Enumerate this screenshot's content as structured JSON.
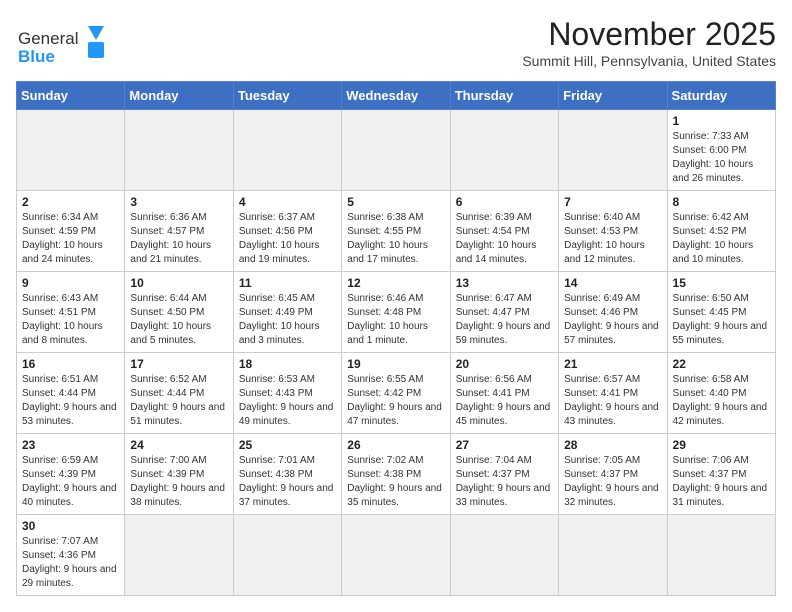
{
  "header": {
    "logo_general": "General",
    "logo_blue": "Blue",
    "title": "November 2025",
    "subtitle": "Summit Hill, Pennsylvania, United States"
  },
  "days_of_week": [
    "Sunday",
    "Monday",
    "Tuesday",
    "Wednesday",
    "Thursday",
    "Friday",
    "Saturday"
  ],
  "weeks": [
    [
      {
        "day": "",
        "empty": true
      },
      {
        "day": "",
        "empty": true
      },
      {
        "day": "",
        "empty": true
      },
      {
        "day": "",
        "empty": true
      },
      {
        "day": "",
        "empty": true
      },
      {
        "day": "",
        "empty": true
      },
      {
        "day": "1",
        "sunrise": "7:33 AM",
        "sunset": "6:00 PM",
        "daylight": "10 hours and 26 minutes."
      }
    ],
    [
      {
        "day": "2",
        "sunrise": "6:34 AM",
        "sunset": "4:59 PM",
        "daylight": "10 hours and 24 minutes."
      },
      {
        "day": "3",
        "sunrise": "6:36 AM",
        "sunset": "4:57 PM",
        "daylight": "10 hours and 21 minutes."
      },
      {
        "day": "4",
        "sunrise": "6:37 AM",
        "sunset": "4:56 PM",
        "daylight": "10 hours and 19 minutes."
      },
      {
        "day": "5",
        "sunrise": "6:38 AM",
        "sunset": "4:55 PM",
        "daylight": "10 hours and 17 minutes."
      },
      {
        "day": "6",
        "sunrise": "6:39 AM",
        "sunset": "4:54 PM",
        "daylight": "10 hours and 14 minutes."
      },
      {
        "day": "7",
        "sunrise": "6:40 AM",
        "sunset": "4:53 PM",
        "daylight": "10 hours and 12 minutes."
      },
      {
        "day": "8",
        "sunrise": "6:42 AM",
        "sunset": "4:52 PM",
        "daylight": "10 hours and 10 minutes."
      }
    ],
    [
      {
        "day": "9",
        "sunrise": "6:43 AM",
        "sunset": "4:51 PM",
        "daylight": "10 hours and 8 minutes."
      },
      {
        "day": "10",
        "sunrise": "6:44 AM",
        "sunset": "4:50 PM",
        "daylight": "10 hours and 5 minutes."
      },
      {
        "day": "11",
        "sunrise": "6:45 AM",
        "sunset": "4:49 PM",
        "daylight": "10 hours and 3 minutes."
      },
      {
        "day": "12",
        "sunrise": "6:46 AM",
        "sunset": "4:48 PM",
        "daylight": "10 hours and 1 minute."
      },
      {
        "day": "13",
        "sunrise": "6:47 AM",
        "sunset": "4:47 PM",
        "daylight": "9 hours and 59 minutes."
      },
      {
        "day": "14",
        "sunrise": "6:49 AM",
        "sunset": "4:46 PM",
        "daylight": "9 hours and 57 minutes."
      },
      {
        "day": "15",
        "sunrise": "6:50 AM",
        "sunset": "4:45 PM",
        "daylight": "9 hours and 55 minutes."
      }
    ],
    [
      {
        "day": "16",
        "sunrise": "6:51 AM",
        "sunset": "4:44 PM",
        "daylight": "9 hours and 53 minutes."
      },
      {
        "day": "17",
        "sunrise": "6:52 AM",
        "sunset": "4:44 PM",
        "daylight": "9 hours and 51 minutes."
      },
      {
        "day": "18",
        "sunrise": "6:53 AM",
        "sunset": "4:43 PM",
        "daylight": "9 hours and 49 minutes."
      },
      {
        "day": "19",
        "sunrise": "6:55 AM",
        "sunset": "4:42 PM",
        "daylight": "9 hours and 47 minutes."
      },
      {
        "day": "20",
        "sunrise": "6:56 AM",
        "sunset": "4:41 PM",
        "daylight": "9 hours and 45 minutes."
      },
      {
        "day": "21",
        "sunrise": "6:57 AM",
        "sunset": "4:41 PM",
        "daylight": "9 hours and 43 minutes."
      },
      {
        "day": "22",
        "sunrise": "6:58 AM",
        "sunset": "4:40 PM",
        "daylight": "9 hours and 42 minutes."
      }
    ],
    [
      {
        "day": "23",
        "sunrise": "6:59 AM",
        "sunset": "4:39 PM",
        "daylight": "9 hours and 40 minutes."
      },
      {
        "day": "24",
        "sunrise": "7:00 AM",
        "sunset": "4:39 PM",
        "daylight": "9 hours and 38 minutes."
      },
      {
        "day": "25",
        "sunrise": "7:01 AM",
        "sunset": "4:38 PM",
        "daylight": "9 hours and 37 minutes."
      },
      {
        "day": "26",
        "sunrise": "7:02 AM",
        "sunset": "4:38 PM",
        "daylight": "9 hours and 35 minutes."
      },
      {
        "day": "27",
        "sunrise": "7:04 AM",
        "sunset": "4:37 PM",
        "daylight": "9 hours and 33 minutes."
      },
      {
        "day": "28",
        "sunrise": "7:05 AM",
        "sunset": "4:37 PM",
        "daylight": "9 hours and 32 minutes."
      },
      {
        "day": "29",
        "sunrise": "7:06 AM",
        "sunset": "4:37 PM",
        "daylight": "9 hours and 31 minutes."
      }
    ],
    [
      {
        "day": "30",
        "sunrise": "7:07 AM",
        "sunset": "4:36 PM",
        "daylight": "9 hours and 29 minutes."
      },
      {
        "day": "",
        "empty": true
      },
      {
        "day": "",
        "empty": true
      },
      {
        "day": "",
        "empty": true
      },
      {
        "day": "",
        "empty": true
      },
      {
        "day": "",
        "empty": true
      },
      {
        "day": "",
        "empty": true
      }
    ]
  ]
}
